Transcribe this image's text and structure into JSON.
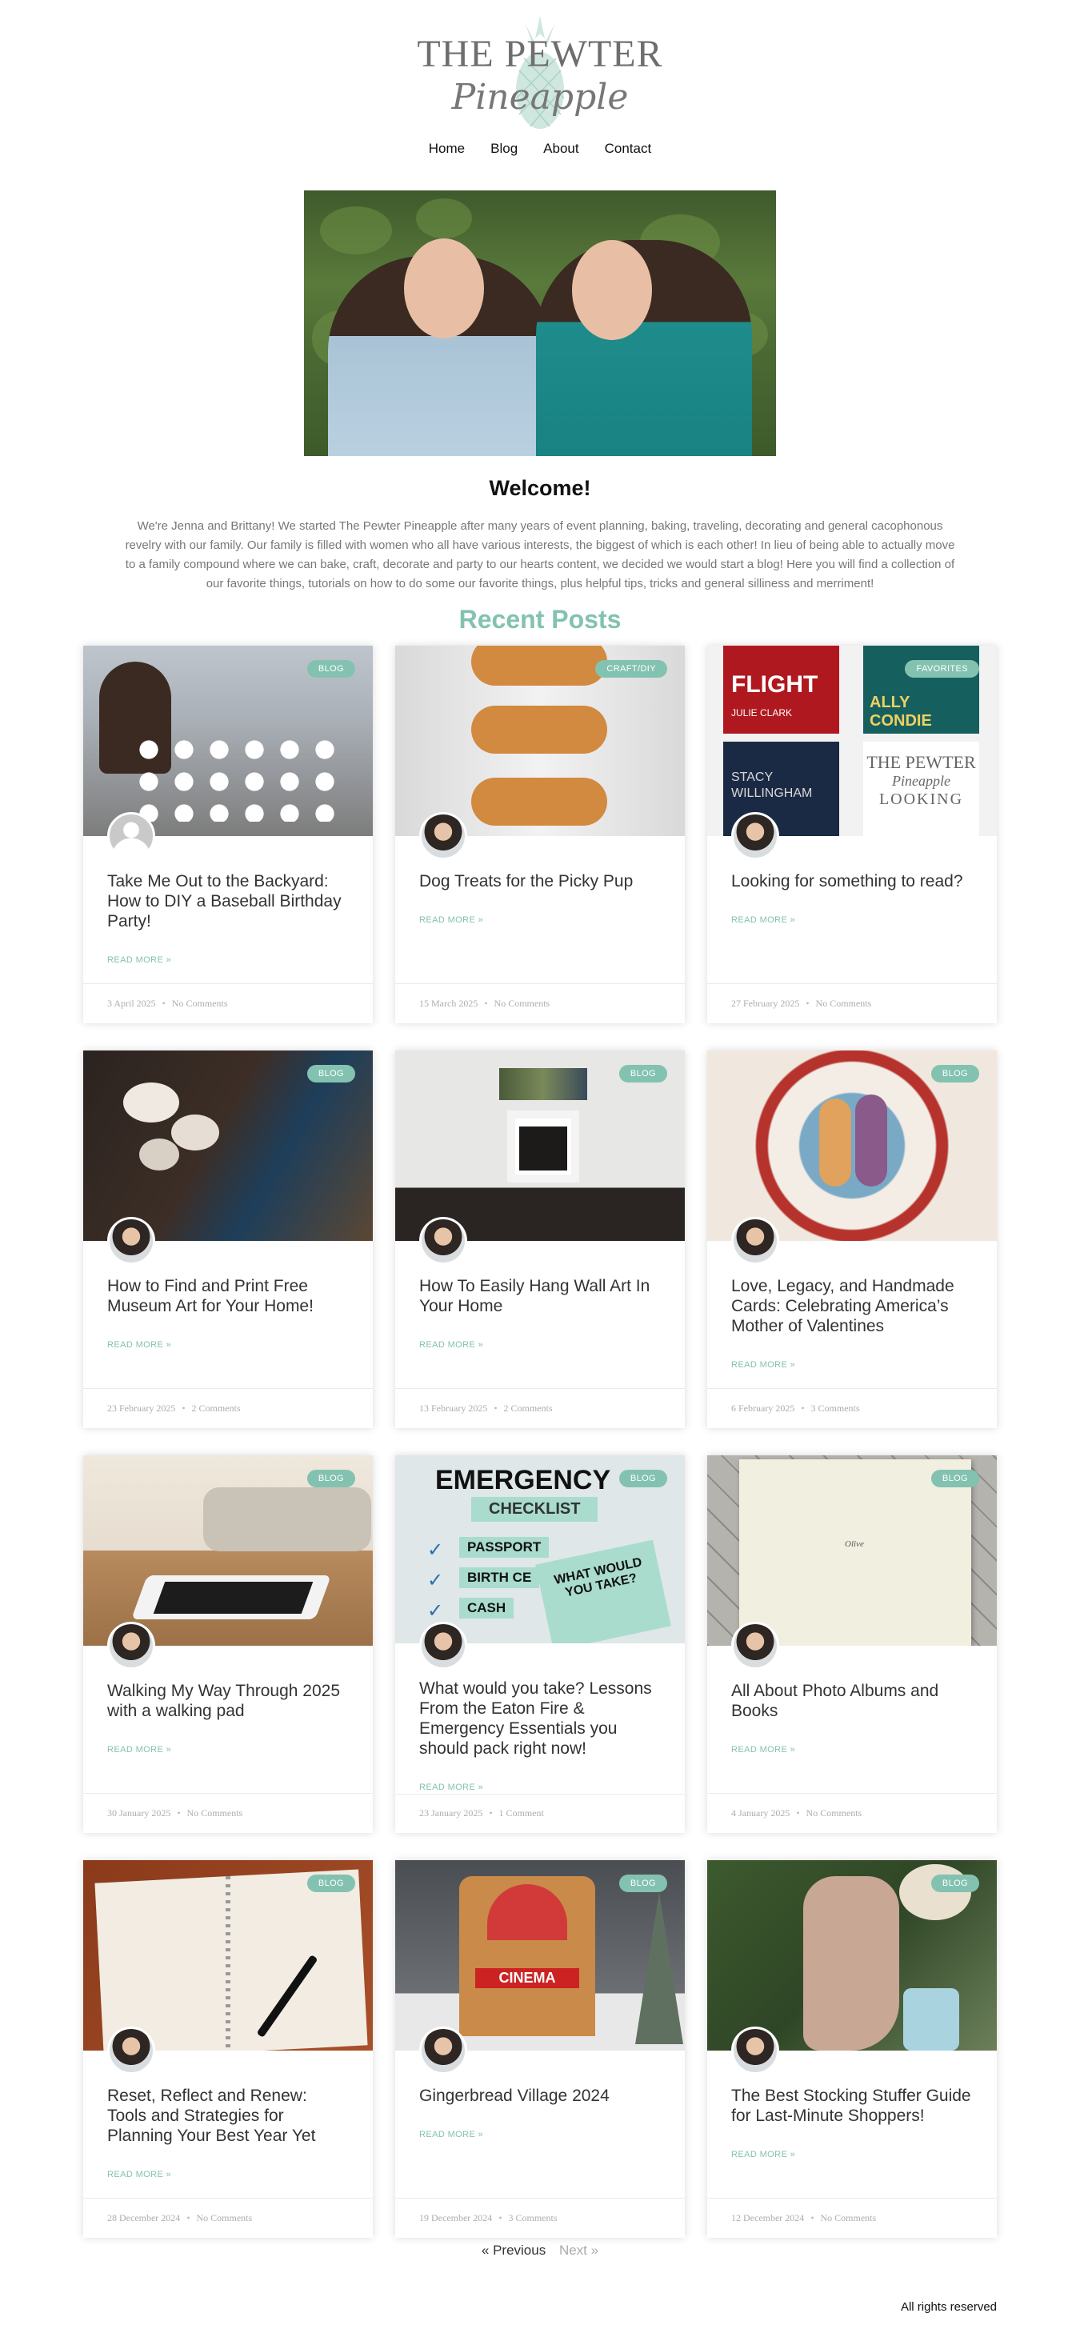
{
  "header": {
    "logo_top": "THE PEWTER",
    "logo_script": "Pineapple",
    "nav": [
      "Home",
      "Blog",
      "About",
      "Contact"
    ]
  },
  "welcome": {
    "title": "Welcome!",
    "text": "We're Jenna and Brittany! We started The Pewter Pineapple after many years of event planning, baking, traveling, decorating and general cacophonous revelry with our family. Our family is filled with women who all have various interests, the biggest of which is each other! In lieu of being able to actually move to a family compound where we can bake, craft, decorate and party to our hearts content, we decided we would start a blog! Here you will find a collection of our favorite things, tutorials on how to do some our favorite things, plus helpful tips, tricks and general silliness and merriment!"
  },
  "recent_title": "Recent Posts",
  "read_more_label": "READ MORE »",
  "posts": [
    {
      "badge": "BLOG",
      "title": "Take Me Out to the Backyard: How to DIY a Baseball Birthday Party!",
      "date": "3 April 2025",
      "comments": "No Comments"
    },
    {
      "badge": "CRAFT/DIY",
      "title": "Dog Treats for the Picky Pup",
      "date": "15 March 2025",
      "comments": "No Comments"
    },
    {
      "badge": "FAVORITES",
      "title": "Looking for something to read?",
      "date": "27 February 2025",
      "comments": "No Comments"
    },
    {
      "badge": "BLOG",
      "title": "How to Find and Print Free Museum Art for Your Home!",
      "date": "23 February 2025",
      "comments": "2 Comments"
    },
    {
      "badge": "BLOG",
      "title": "How To Easily Hang Wall Art In Your Home",
      "date": "13 February 2025",
      "comments": "2 Comments"
    },
    {
      "badge": "BLOG",
      "title": "Love, Legacy, and Handmade Cards: Celebrating America’s Mother of Valentines",
      "date": "6 February 2025",
      "comments": "3 Comments"
    },
    {
      "badge": "BLOG",
      "title": "Walking My Way Through 2025 with a walking pad",
      "date": "30 January 2025",
      "comments": "No Comments"
    },
    {
      "badge": "BLOG",
      "title": "What would you take? Lessons From the Eaton Fire & Emergency Essentials you should pack right now!",
      "date": "23 January 2025",
      "comments": "1 Comment"
    },
    {
      "badge": "BLOG",
      "title": "All About Photo Albums and Books",
      "date": "4 January 2025",
      "comments": "No Comments"
    },
    {
      "badge": "BLOG",
      "title": "Reset, Reflect and Renew: Tools and Strategies for Planning Your Best Year Yet",
      "date": "28 December 2024",
      "comments": "No Comments"
    },
    {
      "badge": "BLOG",
      "title": "Gingerbread Village 2024",
      "date": "19 December 2024",
      "comments": "3 Comments"
    },
    {
      "badge": "BLOG",
      "title": "The Best Stocking Stuffer Guide for Last-Minute Shoppers!",
      "date": "12 December 2024",
      "comments": "No Comments"
    }
  ],
  "thumb_text": {
    "book_flight": "FLIGHT",
    "book_julie": "JULIE CLARK",
    "book_ally": "ALLY CONDIE",
    "book_stacy": "STACY WILLINGHAM",
    "book_pewter": "THE PEWTER",
    "book_pineapple": "Pineapple",
    "book_looking": "LOOKING",
    "emergency": "EMERGENCY",
    "checklist": "CHECKLIST",
    "passport": "PASSPORT",
    "birth": "BIRTH CE",
    "cash": "CASH",
    "what": "WHAT WOULD YOU TAKE?",
    "album": "Olive",
    "cinema": "CINEMA"
  },
  "pagination": {
    "prev": "« Previous",
    "next": "Next »"
  },
  "footer": {
    "text": "All rights reserved"
  },
  "colors": {
    "accent": "#83c2b0",
    "meta": "#adadad"
  }
}
